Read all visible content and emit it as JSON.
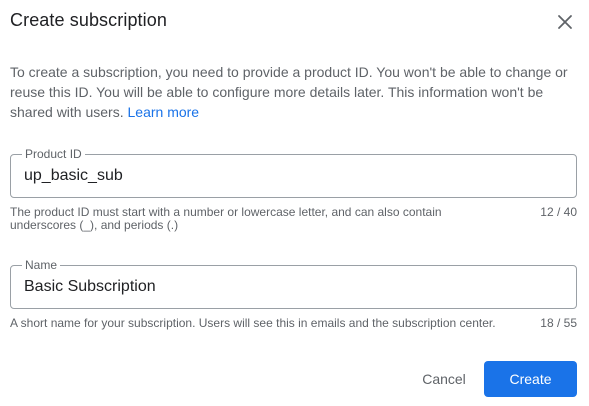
{
  "dialog": {
    "title": "Create subscription",
    "description": "To create a subscription, you need to provide a product ID. You won't be able to change or reuse this ID. You will be able to configure more details later. This information won't be shared with users.",
    "learn_more": "Learn more"
  },
  "product_id": {
    "label": "Product ID",
    "value": "up_basic_sub",
    "hint": "The product ID must start with a number or lowercase letter, and can also contain underscores (_), and periods (.)",
    "counter": "12 / 40"
  },
  "name": {
    "label": "Name",
    "value": "Basic Subscription",
    "hint": "A short name for your subscription. Users will see this in emails and the subscription center.",
    "counter": "18 / 55"
  },
  "actions": {
    "cancel_label": "Cancel",
    "create_label": "Create"
  },
  "icons": {
    "close": "close-icon"
  },
  "colors": {
    "primary": "#1a73e8",
    "text": "#202124",
    "secondary_text": "#5f6368",
    "border": "#9aa0a6"
  }
}
